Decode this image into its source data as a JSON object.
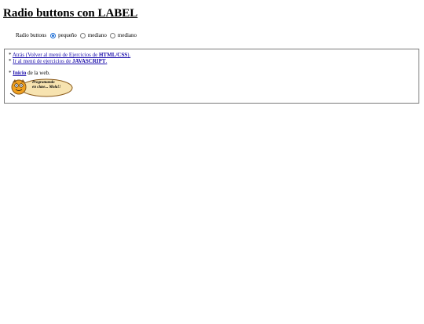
{
  "page": {
    "title": "Radio buttons con LABEL"
  },
  "radio_group": {
    "label": "Radio buttons",
    "options": [
      {
        "label": "pequeño",
        "checked": true
      },
      {
        "label": "mediano",
        "checked": false
      },
      {
        "label": "mediano",
        "checked": false
      }
    ]
  },
  "nav": {
    "back": {
      "bullet": "*",
      "link_prefix": "Atrás (Volver al menú de Ejercicios de ",
      "link_bold": "HTML/CSS",
      "link_suffix": ")."
    },
    "js": {
      "bullet": "*",
      "link_prefix": "Ir al menú de ejercicios de ",
      "link_bold": "JAVASCRIPT",
      "link_suffix": "."
    },
    "home": {
      "bullet": "*",
      "link_bold": "Inicio",
      "link_suffix": " de la web."
    }
  },
  "logo": {
    "text_line1": "Programando",
    "text_line2": "en clase... Mola!!",
    "colors": {
      "fill": "#f7e3b0",
      "stroke": "#8a5a1a",
      "face": "#f0a020"
    },
    "icon": "teacher-mascot-icon"
  }
}
